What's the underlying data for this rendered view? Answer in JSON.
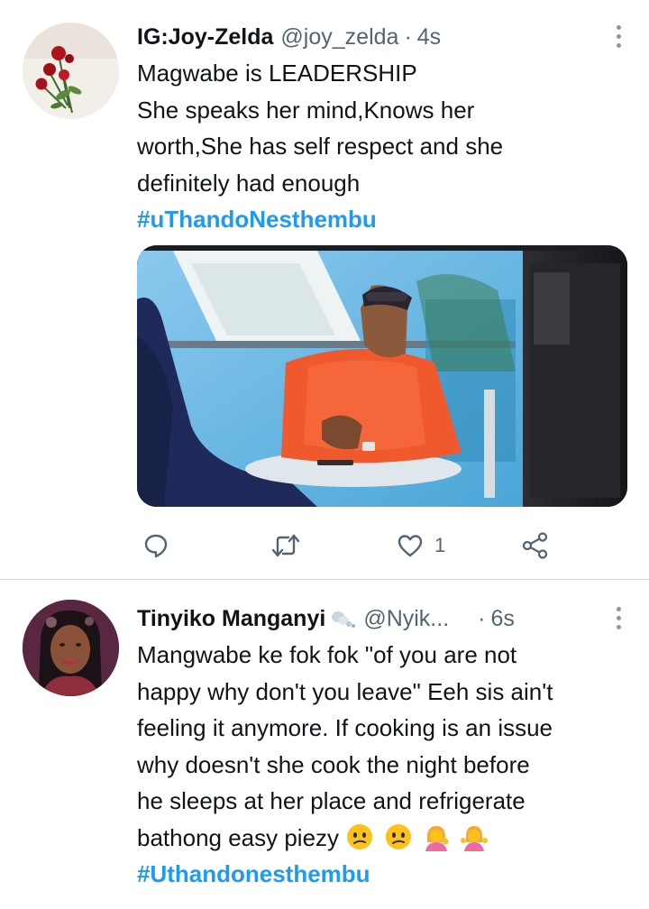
{
  "tweets": [
    {
      "display_name": "IG:Joy-Zelda",
      "handle": "@joy_zelda",
      "separator": "·",
      "time": "4s",
      "avatar_icon": "red-roses-avatar",
      "text_lines": [
        "Magwabe is LEADERSHIP",
        "She speaks her mind,Knows her",
        "worth,She has self respect and she",
        "definitely had enough"
      ],
      "hashtag": "#uThandoNesthembu",
      "media_icon": "tv-scene-photo",
      "actions": {
        "reply_icon": "reply-icon",
        "retweet_icon": "retweet-icon",
        "like_icon": "heart-icon",
        "like_count": "1",
        "share_icon": "share-icon"
      }
    },
    {
      "display_name": "Tinyiko Manganyi",
      "name_emoji": "dash-emoji",
      "handle": "@Nyik...",
      "separator": "·",
      "time": "6s",
      "avatar_icon": "woman-portrait-avatar",
      "text_lines": [
        "Mangwabe ke fok fok \"of you are not",
        "happy why don't you leave\" Eeh sis ain't",
        "feeling it anymore. If cooking is an issue",
        "why doesn't she cook the night before",
        "he sleeps at her place and refrigerate",
        "bathong easy piezy"
      ],
      "emojis": [
        "confused-face-emoji",
        "confused-face-emoji",
        "woman-tipping-hand-emoji",
        "woman-shrugging-emoji"
      ],
      "hashtag": "#Uthandonesthembu"
    }
  ],
  "colors": {
    "link": "#1d9bf0",
    "text": "#0f1419",
    "muted": "#536471",
    "divider": "#cfd9de"
  }
}
